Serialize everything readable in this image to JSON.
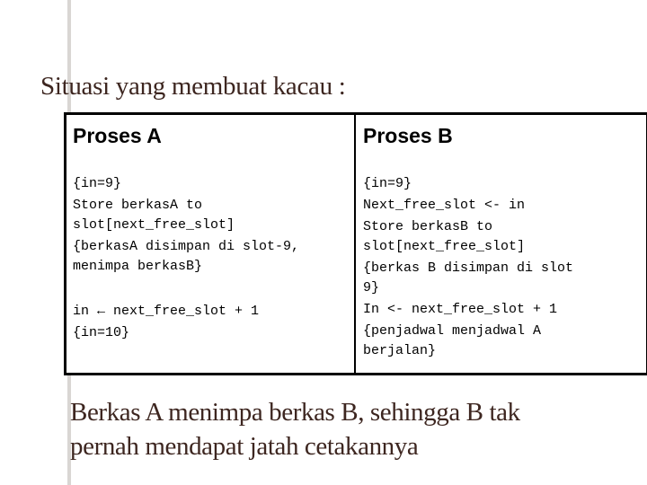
{
  "slide": {
    "title": "Situasi yang membuat kacau :",
    "table": {
      "process_a": {
        "header": "Proses A",
        "lines": [
          "{in=9}",
          "Store berkasA to",
          "slot[next_free_slot]",
          "{berkasA disimpan di slot-9,",
          "menimpa berkasB}",
          "in ← next_free_slot + 1",
          "{in=10}"
        ]
      },
      "process_b": {
        "header": "Proses B",
        "lines": [
          "{in=9}",
          "Next_free_slot <- in",
          "Store berkasB to",
          "slot[next_free_slot]",
          "{berkas B disimpan di slot",
          "9}",
          "In <- next_free_slot + 1",
          "{penjadwal menjadwal A",
          "berjalan}"
        ]
      }
    },
    "caption_lines": [
      "Berkas A menimpa berkas B, sehingga B tak",
      "pernah mendapat jatah cetakannya"
    ],
    "colors": {
      "text_brown": "#3d2620",
      "border": "#000000",
      "accent_line": "#d9d6d3"
    }
  }
}
